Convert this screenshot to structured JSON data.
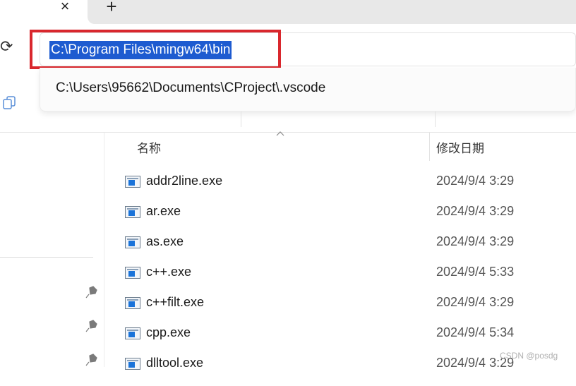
{
  "tabs": {
    "close_symbol": "×",
    "new_tab_symbol": "+"
  },
  "toolbar": {
    "refresh_symbol": "⟳"
  },
  "address_bar": {
    "value": "C:\\Program Files\\mingw64\\bin"
  },
  "suggestions": [
    {
      "label": "C:\\Users\\95662\\Documents\\CProject\\.vscode"
    }
  ],
  "columns": {
    "name": "名称",
    "modified": "修改日期"
  },
  "files": [
    {
      "name": "addr2line.exe",
      "modified": "2024/9/4 3:29"
    },
    {
      "name": "ar.exe",
      "modified": "2024/9/4 3:29"
    },
    {
      "name": "as.exe",
      "modified": "2024/9/4 3:29"
    },
    {
      "name": "c++.exe",
      "modified": "2024/9/4 5:33"
    },
    {
      "name": "c++filt.exe",
      "modified": "2024/9/4 3:29"
    },
    {
      "name": "cpp.exe",
      "modified": "2024/9/4 5:34"
    },
    {
      "name": "dlltool.exe",
      "modified": "2024/9/4 3:29"
    }
  ],
  "watermark": "CSDN @posdg",
  "colors": {
    "highlight_border": "#d9272d",
    "selection": "#1e5bd0",
    "file_icon": "#1a73d9"
  },
  "icons": [
    "close-icon",
    "plus-icon",
    "refresh-icon",
    "copy-icon",
    "pin-icon",
    "sort-caret-icon",
    "exe-file-icon"
  ]
}
